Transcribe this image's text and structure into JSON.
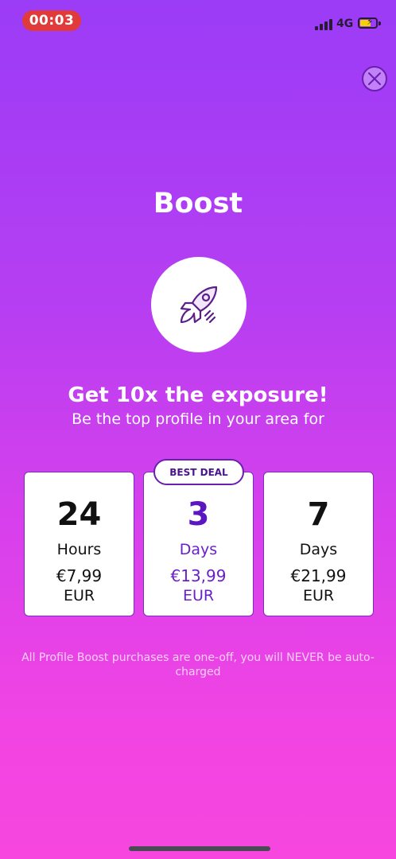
{
  "status_bar": {
    "timer": "00:03",
    "network": "4G"
  },
  "screen": {
    "title": "Boost",
    "headline": "Get 10x the exposure!",
    "subline": "Be the top profile in your area for",
    "badge": "BEST DEAL",
    "disclaimer": "All Profile Boost purchases are one-off, you will NEVER be auto-charged"
  },
  "plans": [
    {
      "amount": "24",
      "unit": "Hours",
      "price": "€7,99",
      "currency": "EUR"
    },
    {
      "amount": "3",
      "unit": "Days",
      "price": "€13,99",
      "currency": "EUR",
      "selected": true
    },
    {
      "amount": "7",
      "unit": "Days",
      "price": "€21,99",
      "currency": "EUR"
    }
  ],
  "icons": {
    "close": "close-icon",
    "rocket": "rocket-icon",
    "signal": "signal-icon",
    "battery": "battery-charging-icon"
  },
  "colors": {
    "accent": "#6a1fc8",
    "gradient_top": "#9b3cf7",
    "gradient_bottom": "#f746df",
    "timer_bg": "#e03a3a"
  }
}
